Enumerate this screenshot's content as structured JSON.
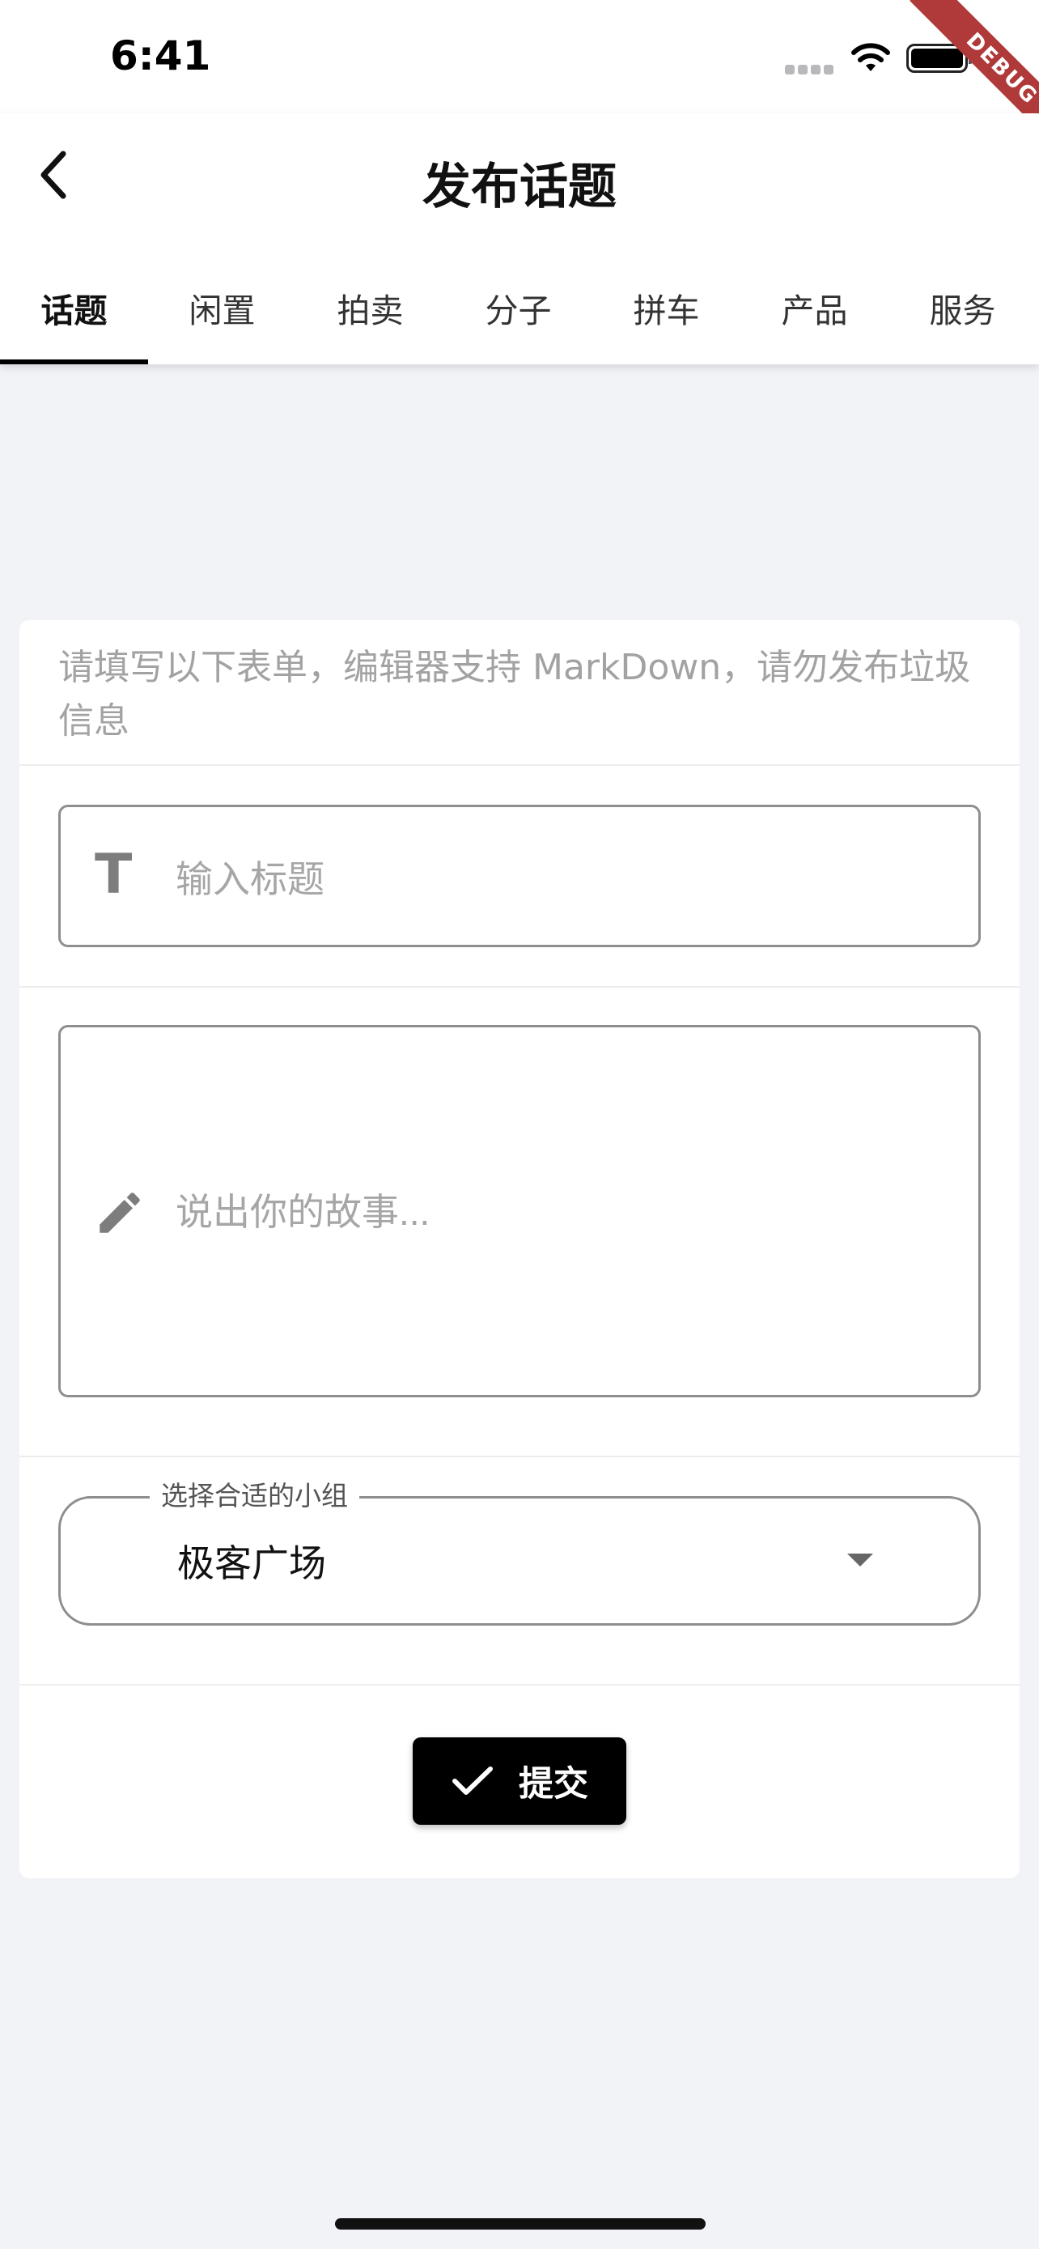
{
  "status_bar": {
    "time": "6:41",
    "debug_label": "DEBUG"
  },
  "header": {
    "title": "发布话题",
    "back_icon": "chevron-left-icon"
  },
  "tabs": [
    {
      "label": "话题",
      "active": true
    },
    {
      "label": "闲置",
      "active": false
    },
    {
      "label": "拍卖",
      "active": false
    },
    {
      "label": "分子",
      "active": false
    },
    {
      "label": "拼车",
      "active": false
    },
    {
      "label": "产品",
      "active": false
    },
    {
      "label": "服务",
      "active": false
    }
  ],
  "form": {
    "notice": "请填写以下表单，编辑器支持 MarkDown，请勿发布垃圾信息",
    "title_field": {
      "icon": "text-format-icon",
      "placeholder": "输入标题",
      "value": ""
    },
    "story_field": {
      "icon": "pencil-icon",
      "placeholder": "说出你的故事...",
      "value": ""
    },
    "group_select": {
      "label": "选择合适的小组",
      "value": "极客广场",
      "icon": "dropdown-arrow-icon"
    },
    "submit": {
      "label": "提交",
      "icon": "check-icon"
    }
  },
  "colors": {
    "background": "#f2f3f7",
    "card": "#ffffff",
    "accent": "#000000",
    "debug_banner": "#b03a3a",
    "placeholder": "#a6a6a6"
  }
}
